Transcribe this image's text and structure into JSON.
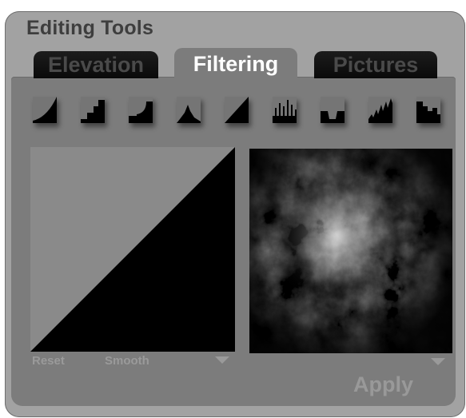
{
  "panel": {
    "title": "Editing Tools"
  },
  "tabs": [
    {
      "label": "Elevation",
      "active": false
    },
    {
      "label": "Filtering",
      "active": true
    },
    {
      "label": "Pictures",
      "active": false
    }
  ],
  "filters": [
    {
      "name": "curve-concave-icon"
    },
    {
      "name": "stairs-icon"
    },
    {
      "name": "step-icon"
    },
    {
      "name": "peak-icon"
    },
    {
      "name": "diagonal-ramp-icon"
    },
    {
      "name": "spikes-icon"
    },
    {
      "name": "valley-icon"
    },
    {
      "name": "jagged-peaks-icon"
    },
    {
      "name": "blocky-terrain-icon"
    }
  ],
  "curve_editor": {
    "reset_label": "Reset",
    "smooth_label": "Smooth"
  },
  "actions": {
    "apply_label": "Apply"
  },
  "colors": {
    "panel_background": "#a2a2a2",
    "inner_background": "#7c7c7c",
    "tab_inactive": "#121212",
    "tab_active_text": "#ffffff",
    "muted_text": "#9a9a9a"
  }
}
